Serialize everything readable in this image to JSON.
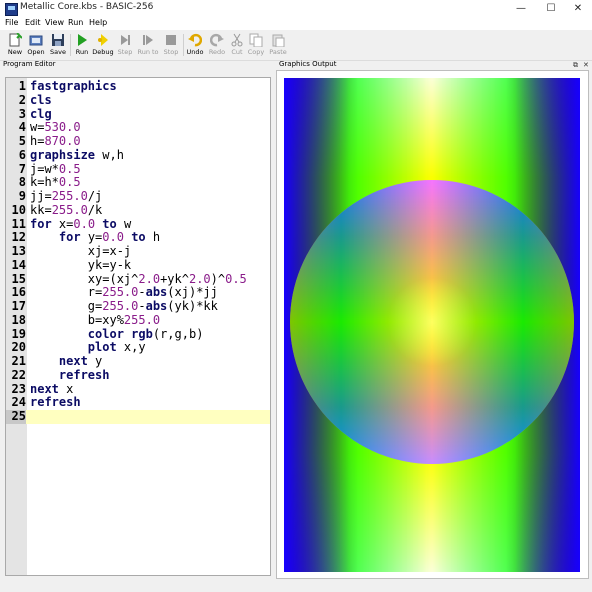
{
  "window": {
    "title": "Metallic Core.kbs - BASIC-256",
    "minimize_glyph": "—",
    "maximize_glyph": "☐",
    "close_glyph": "✕"
  },
  "menu": [
    "File",
    "Edit",
    "View",
    "Run",
    "Help"
  ],
  "toolbar": [
    {
      "label": "New",
      "icon": "new-file-icon",
      "enabled": true
    },
    {
      "label": "Open",
      "icon": "open-folder-icon",
      "enabled": true
    },
    {
      "label": "Save",
      "icon": "save-disk-icon",
      "enabled": true
    },
    {
      "label": "Run",
      "icon": "run-play-icon",
      "enabled": true
    },
    {
      "label": "Debug",
      "icon": "debug-bug-icon",
      "enabled": true
    },
    {
      "label": "Step",
      "icon": "step-icon",
      "enabled": false
    },
    {
      "label": "Run to",
      "icon": "run-to-icon",
      "enabled": false
    },
    {
      "label": "Stop",
      "icon": "stop-icon",
      "enabled": false
    },
    {
      "label": "Undo",
      "icon": "undo-icon",
      "enabled": true
    },
    {
      "label": "Redo",
      "icon": "redo-icon",
      "enabled": false
    },
    {
      "label": "Cut",
      "icon": "cut-scissors-icon",
      "enabled": false
    },
    {
      "label": "Copy",
      "icon": "copy-icon",
      "enabled": false
    },
    {
      "label": "Paste",
      "icon": "paste-icon",
      "enabled": false
    }
  ],
  "editor": {
    "panel_title": "Program Editor",
    "current_line": 25,
    "lines": [
      [
        [
          "kw",
          "fastgraphics"
        ]
      ],
      [
        [
          "kw",
          "cls"
        ]
      ],
      [
        [
          "kw",
          "clg"
        ]
      ],
      [
        [
          "plain",
          "w="
        ],
        [
          "num",
          "530.0"
        ]
      ],
      [
        [
          "plain",
          "h="
        ],
        [
          "num",
          "870.0"
        ]
      ],
      [
        [
          "kw",
          "graphsize"
        ],
        [
          "plain",
          " w,h"
        ]
      ],
      [
        [
          "plain",
          "j=w*"
        ],
        [
          "num",
          "0.5"
        ]
      ],
      [
        [
          "plain",
          "k=h*"
        ],
        [
          "num",
          "0.5"
        ]
      ],
      [
        [
          "plain",
          "jj="
        ],
        [
          "num",
          "255.0"
        ],
        [
          "plain",
          "/j"
        ]
      ],
      [
        [
          "plain",
          "kk="
        ],
        [
          "num",
          "255.0"
        ],
        [
          "plain",
          "/k"
        ]
      ],
      [
        [
          "kw",
          "for"
        ],
        [
          "plain",
          " x="
        ],
        [
          "num",
          "0.0"
        ],
        [
          "plain",
          " "
        ],
        [
          "kw",
          "to"
        ],
        [
          "plain",
          " w"
        ]
      ],
      [
        [
          "plain",
          "    "
        ],
        [
          "kw",
          "for"
        ],
        [
          "plain",
          " y="
        ],
        [
          "num",
          "0.0"
        ],
        [
          "plain",
          " "
        ],
        [
          "kw",
          "to"
        ],
        [
          "plain",
          " h"
        ]
      ],
      [
        [
          "plain",
          "        xj=x-j"
        ]
      ],
      [
        [
          "plain",
          "        yk=y-k"
        ]
      ],
      [
        [
          "plain",
          "        xy=(xj^"
        ],
        [
          "num",
          "2.0"
        ],
        [
          "plain",
          "+yk^"
        ],
        [
          "num",
          "2.0"
        ],
        [
          "plain",
          ")^"
        ],
        [
          "num",
          "0.5"
        ]
      ],
      [
        [
          "plain",
          "        r="
        ],
        [
          "num",
          "255.0"
        ],
        [
          "plain",
          "-"
        ],
        [
          "kw",
          "abs"
        ],
        [
          "plain",
          "(xj)*jj"
        ]
      ],
      [
        [
          "plain",
          "        g="
        ],
        [
          "num",
          "255.0"
        ],
        [
          "plain",
          "-"
        ],
        [
          "kw",
          "abs"
        ],
        [
          "plain",
          "(yk)*kk"
        ]
      ],
      [
        [
          "plain",
          "        b=xy%"
        ],
        [
          "num",
          "255.0"
        ]
      ],
      [
        [
          "plain",
          "        "
        ],
        [
          "kw",
          "color"
        ],
        [
          "plain",
          " "
        ],
        [
          "kw",
          "rgb"
        ],
        [
          "plain",
          "(r,g,b)"
        ]
      ],
      [
        [
          "plain",
          "        "
        ],
        [
          "kw",
          "plot"
        ],
        [
          "plain",
          " x,y"
        ]
      ],
      [
        [
          "plain",
          "    "
        ],
        [
          "kw",
          "next"
        ],
        [
          "plain",
          " y"
        ]
      ],
      [
        [
          "plain",
          "    "
        ],
        [
          "kw",
          "refresh"
        ]
      ],
      [
        [
          "kw",
          "next"
        ],
        [
          "plain",
          " x"
        ]
      ],
      [
        [
          "kw",
          "refresh"
        ]
      ],
      []
    ]
  },
  "graphics": {
    "panel_title": "Graphics Output",
    "restore_glyph": "⧉",
    "close_glyph": "✕"
  },
  "colors": {
    "keyword": "#0b0b64",
    "number": "#8a1c8a",
    "current_line": "#ffffc0"
  }
}
